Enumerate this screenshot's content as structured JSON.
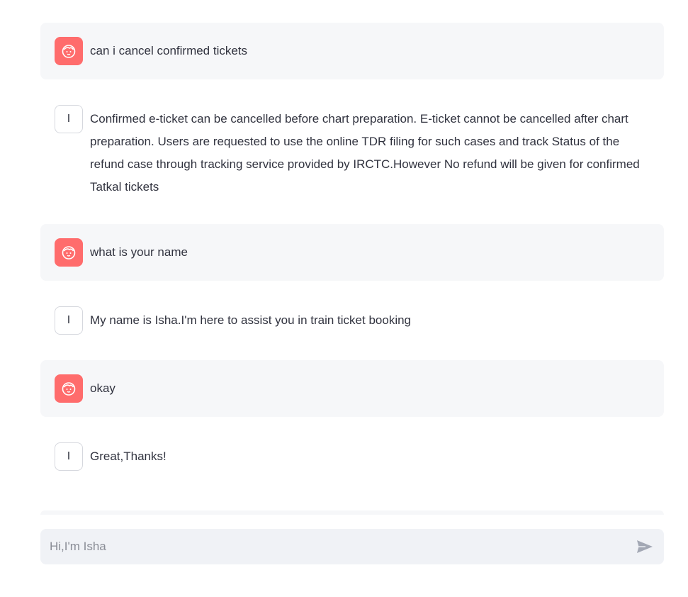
{
  "messages": [
    {
      "role": "user",
      "avatar_icon": "smiley-face-icon",
      "text": "can i cancel confirmed tickets"
    },
    {
      "role": "assistant",
      "avatar_letter": "I",
      "text": "Confirmed e-ticket can be cancelled before chart preparation. E-ticket cannot be cancelled after chart preparation. Users are requested to use the online TDR filing for such cases and track Status of the refund case through tracking service provided by IRCTC.However No refund will be given for confirmed Tatkal tickets"
    },
    {
      "role": "user",
      "avatar_icon": "smiley-face-icon",
      "text": "what is your name"
    },
    {
      "role": "assistant",
      "avatar_letter": "I",
      "text": "My name is Isha.I'm here to assist you in train ticket booking"
    },
    {
      "role": "user",
      "avatar_icon": "smiley-face-icon",
      "text": "okay"
    },
    {
      "role": "assistant",
      "avatar_letter": "I",
      "text": "Great,Thanks!"
    }
  ],
  "chat_input": {
    "placeholder": "Hi,I'm Isha",
    "value": "",
    "send_icon": "send-arrow-icon"
  },
  "colors": {
    "user_avatar": "#ff6c6c",
    "user_bubble": "#f6f7f9",
    "input_bg": "#f0f2f6",
    "text": "#31333f"
  }
}
